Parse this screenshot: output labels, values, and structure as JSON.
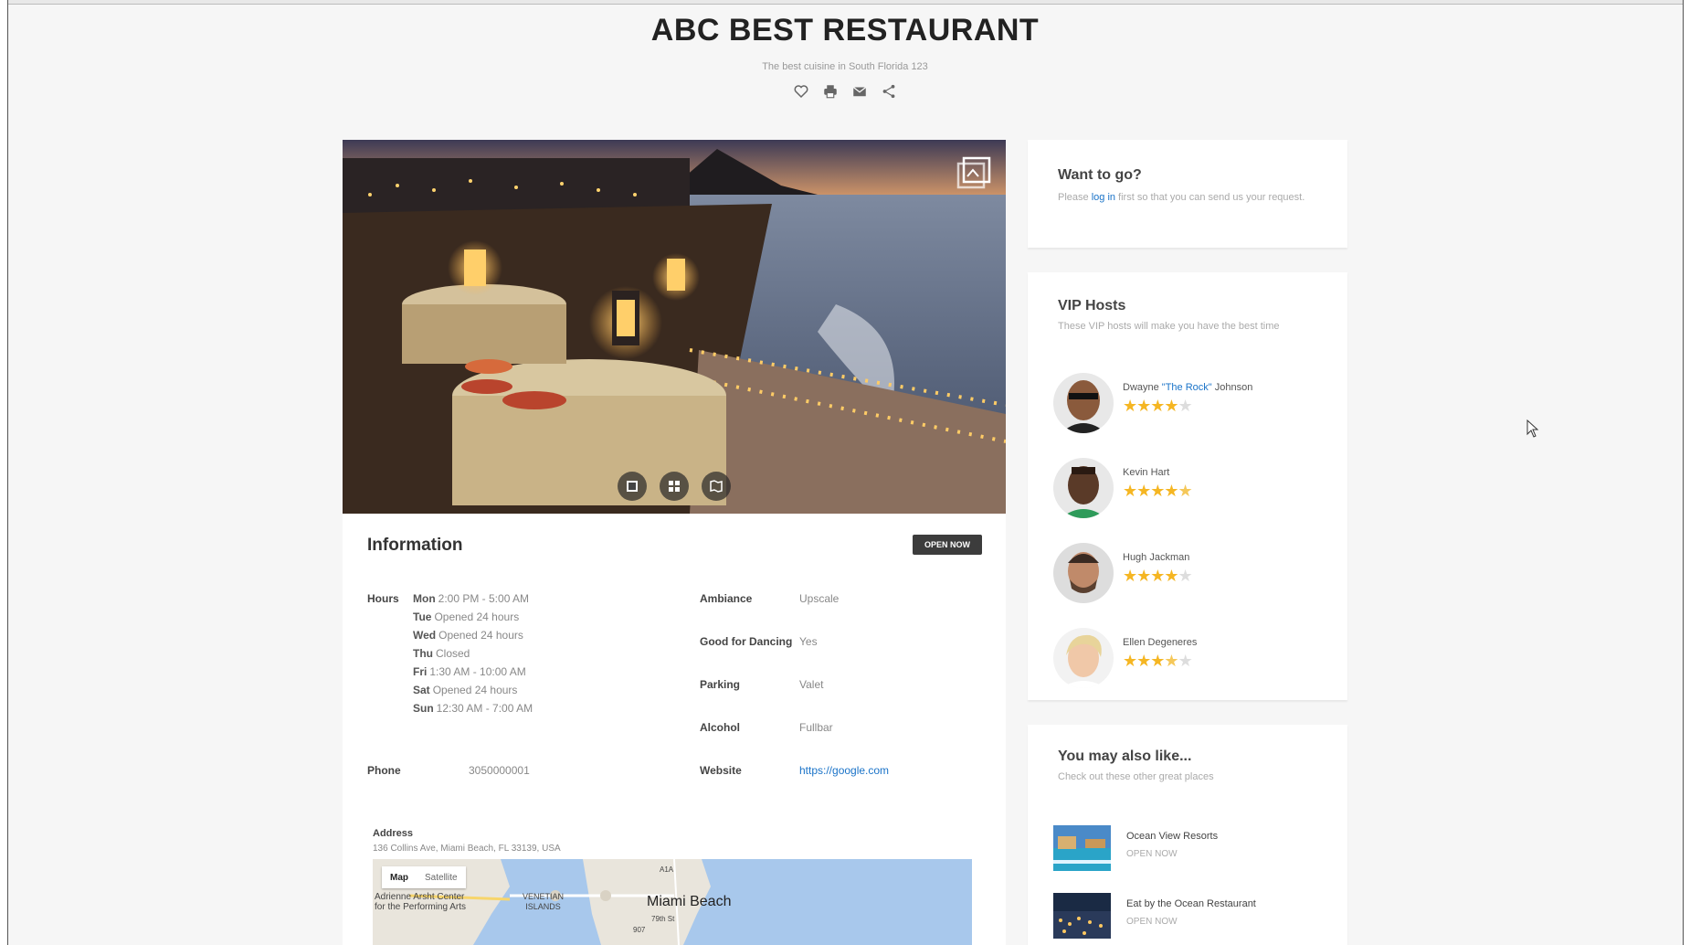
{
  "header": {
    "title": "ABC BEST RESTAURANT",
    "subtitle": "The best cuisine in South Florida 123",
    "icons": [
      "heart-icon",
      "print-icon",
      "email-icon",
      "share-icon"
    ]
  },
  "information": {
    "title": "Information",
    "status_badge": "OPEN NOW",
    "hours_label": "Hours",
    "hours": [
      {
        "day": "Mon",
        "time": "2:00 PM - 5:00 AM"
      },
      {
        "day": "Tue",
        "time": "Opened 24 hours"
      },
      {
        "day": "Wed",
        "time": "Opened 24 hours"
      },
      {
        "day": "Thu",
        "time": "Closed"
      },
      {
        "day": "Fri",
        "time": "1:30 AM - 10:00 AM"
      },
      {
        "day": "Sat",
        "time": "Opened 24 hours"
      },
      {
        "day": "Sun",
        "time": "12:30 AM - 7:00 AM"
      }
    ],
    "phone_label": "Phone",
    "phone": "3050000001",
    "ambiance_label": "Ambiance",
    "ambiance": "Upscale",
    "dancing_label": "Good for Dancing",
    "dancing": "Yes",
    "parking_label": "Parking",
    "parking": "Valet",
    "alcohol_label": "Alcohol",
    "alcohol": "Fullbar",
    "website_label": "Website",
    "website": "https://google.com",
    "address_label": "Address",
    "address": "136 Collins Ave, Miami Beach, FL 33139, USA",
    "map": {
      "tab_map": "Map",
      "tab_satellite": "Satellite",
      "city": "Miami Beach",
      "label_arsht_1": "Adrienne Arsht Center",
      "label_arsht_2": "for the Performing Arts",
      "label_venetian_1": "VENETIAN",
      "label_venetian_2": "ISLANDS",
      "label_street": "79th St",
      "label_route": "A1A",
      "label_route2": "907"
    }
  },
  "want_to_go": {
    "title": "Want to go?",
    "text_before": "Please ",
    "link": "log in",
    "text_after": " first so that you can send us your request."
  },
  "vip_hosts": {
    "title": "VIP Hosts",
    "subtitle": "These VIP hosts will make you have the best time",
    "hosts": [
      {
        "name_before": "Dwayne ",
        "nickname": "\"The Rock\"",
        "name_after": " Johnson",
        "rating": 4.0
      },
      {
        "name": "Kevin Hart",
        "rating": 4.5
      },
      {
        "name": "Hugh Jackman",
        "rating": 4.0
      },
      {
        "name": "Ellen Degeneres",
        "rating": 3.5
      }
    ]
  },
  "also_like": {
    "title": "You may also like...",
    "subtitle": "Check out these other great places",
    "places": [
      {
        "name": "Ocean View Resorts",
        "status": "OPEN NOW"
      },
      {
        "name": "Eat by the Ocean Restaurant",
        "status": "OPEN NOW"
      }
    ]
  },
  "colors": {
    "accent_link": "#1a73c8",
    "star": "#f5b623",
    "badge_bg": "#3c3c3c",
    "page_bg": "#f6f6f6"
  }
}
